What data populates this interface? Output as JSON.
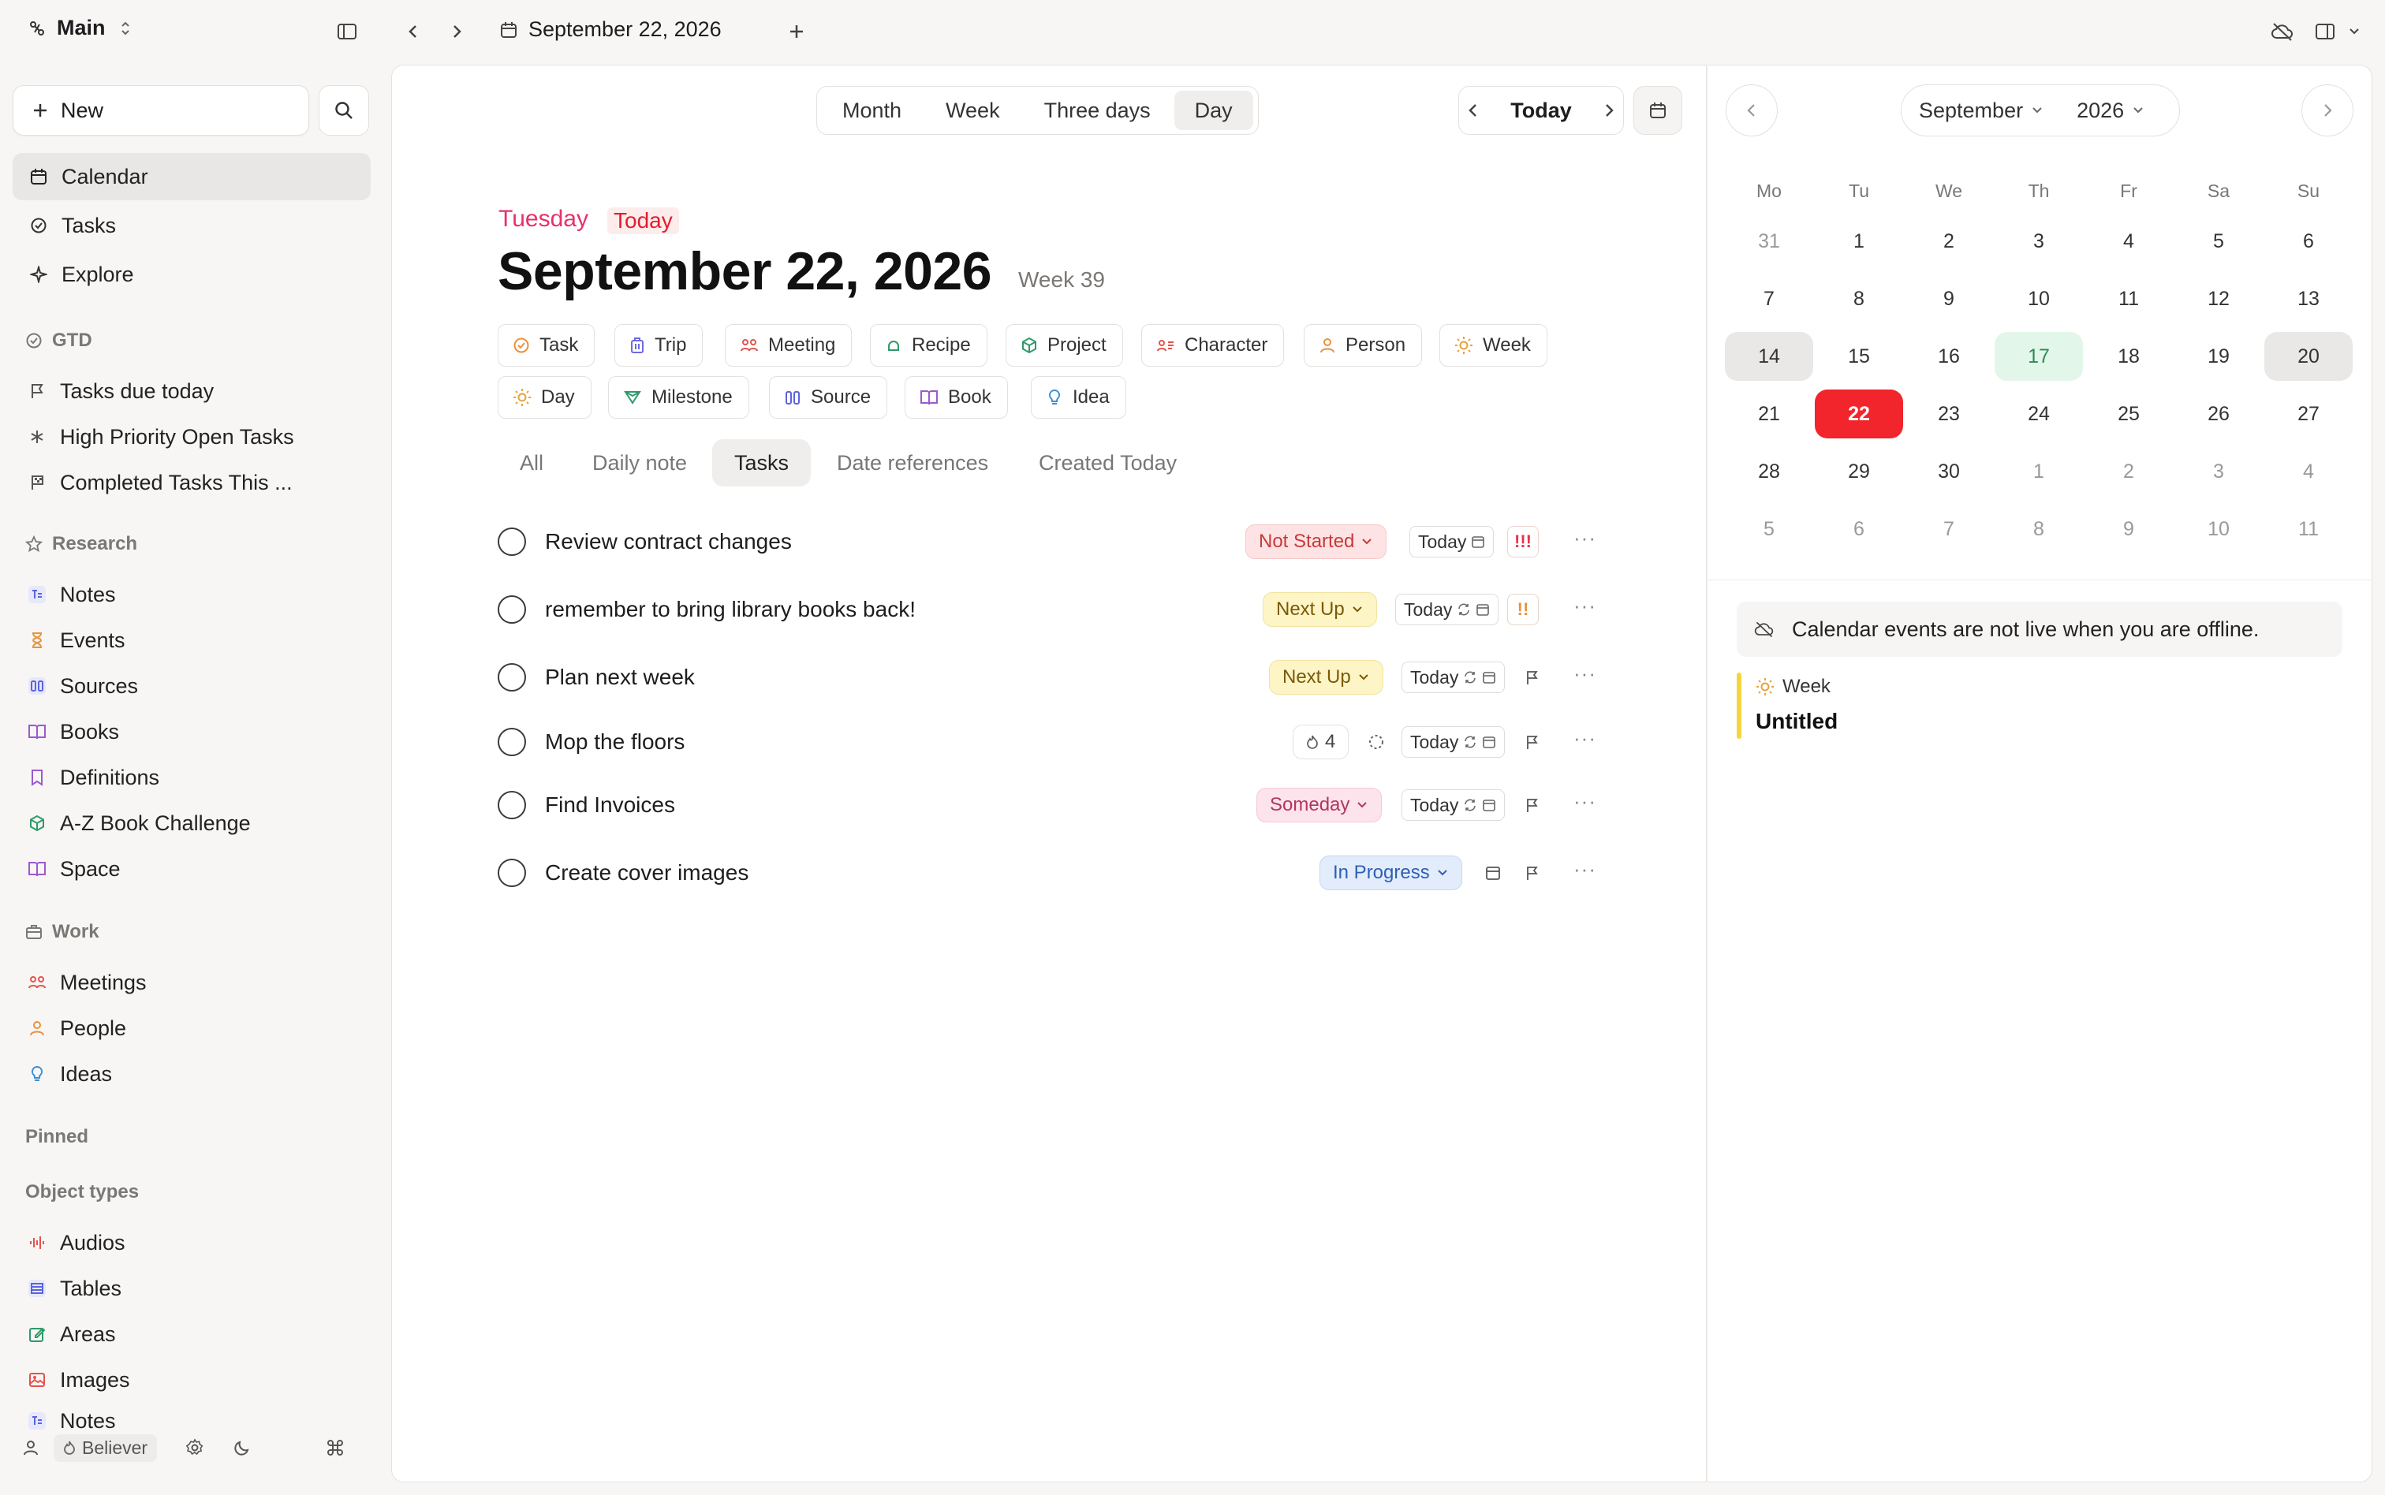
{
  "topbar": {
    "workspace": "Main",
    "date_title": "September 22, 2026"
  },
  "sidebar": {
    "new_label": "New",
    "nav": [
      {
        "label": "Calendar"
      },
      {
        "label": "Tasks"
      },
      {
        "label": "Explore"
      }
    ],
    "gtd": {
      "title": "GTD",
      "items": [
        {
          "label": "Tasks due today"
        },
        {
          "label": "High Priority Open Tasks"
        },
        {
          "label": "Completed Tasks This ..."
        }
      ]
    },
    "research": {
      "title": "Research",
      "items": [
        {
          "label": "Notes"
        },
        {
          "label": "Events"
        },
        {
          "label": "Sources"
        },
        {
          "label": "Books"
        },
        {
          "label": "Definitions"
        },
        {
          "label": "A-Z Book Challenge"
        },
        {
          "label": "Space"
        }
      ]
    },
    "work": {
      "title": "Work",
      "items": [
        {
          "label": "Meetings"
        },
        {
          "label": "People"
        },
        {
          "label": "Ideas"
        }
      ]
    },
    "pinned_title": "Pinned",
    "object_types": {
      "title": "Object types",
      "items": [
        {
          "label": "Audios"
        },
        {
          "label": "Tables"
        },
        {
          "label": "Areas"
        },
        {
          "label": "Images"
        },
        {
          "label": "Notes"
        }
      ]
    },
    "bottom": {
      "plan": "Believer"
    }
  },
  "main": {
    "view_modes": [
      "Month",
      "Week",
      "Three days",
      "Day"
    ],
    "active_view": "Day",
    "today_btn": "Today",
    "day_name": "Tuesday",
    "today_tag": "Today",
    "date_heading": "September 22, 2026",
    "week_label": "Week 39",
    "type_chips": [
      {
        "label": "Task",
        "icon": "task-icon",
        "color": "#e8923c"
      },
      {
        "label": "Trip",
        "icon": "trip-icon",
        "color": "#6e6ae0"
      },
      {
        "label": "Meeting",
        "icon": "meeting-icon",
        "color": "#e5534b"
      },
      {
        "label": "Recipe",
        "icon": "recipe-icon",
        "color": "#2e9a6a"
      },
      {
        "label": "Project",
        "icon": "project-icon",
        "color": "#2e9a6a"
      },
      {
        "label": "Character",
        "icon": "character-icon",
        "color": "#e5534b"
      },
      {
        "label": "Person",
        "icon": "person-icon",
        "color": "#e8923c"
      },
      {
        "label": "Week",
        "icon": "sun-icon",
        "color": "#e8a23c"
      },
      {
        "label": "Day",
        "icon": "sun-icon",
        "color": "#e8a23c"
      },
      {
        "label": "Milestone",
        "icon": "milestone-icon",
        "color": "#2e9a6a"
      },
      {
        "label": "Source",
        "icon": "source-icon",
        "color": "#5c64d9"
      },
      {
        "label": "Book",
        "icon": "book-icon",
        "color": "#9b59d0"
      },
      {
        "label": "Idea",
        "icon": "idea-icon",
        "color": "#3a8fd6"
      }
    ],
    "tabs": [
      "All",
      "Daily note",
      "Tasks",
      "Date references",
      "Created Today"
    ],
    "active_tab": "Tasks",
    "tasks": [
      {
        "title": "Review contract changes",
        "status": "Not Started",
        "date": "Today",
        "priority": "!!!"
      },
      {
        "title": "remember to bring library books back!",
        "status": "Next Up",
        "date": "Today",
        "priority": "!!"
      },
      {
        "title": "Plan next week",
        "status": "Next Up",
        "date": "Today"
      },
      {
        "title": "Mop the floors",
        "count": "4",
        "date": "Today"
      },
      {
        "title": "Find Invoices",
        "status": "Someday",
        "date": "Today"
      },
      {
        "title": "Create cover images",
        "status": "In Progress"
      }
    ]
  },
  "right": {
    "month": "September",
    "year": "2026",
    "weekdays": [
      "Mo",
      "Tu",
      "We",
      "Th",
      "Fr",
      "Sa",
      "Su"
    ],
    "weeks": [
      [
        "31",
        "1",
        "2",
        "3",
        "4",
        "5",
        "6"
      ],
      [
        "7",
        "8",
        "9",
        "10",
        "11",
        "12",
        "13"
      ],
      [
        "14",
        "15",
        "16",
        "17",
        "18",
        "19",
        "20"
      ],
      [
        "21",
        "22",
        "23",
        "24",
        "25",
        "26",
        "27"
      ],
      [
        "28",
        "29",
        "30",
        "1",
        "2",
        "3",
        "4"
      ],
      [
        "5",
        "6",
        "7",
        "8",
        "9",
        "10",
        "11"
      ]
    ],
    "selected_day": "22",
    "offline_notice": "Calendar events are not live when you are offline.",
    "event": {
      "type": "Week",
      "title": "Untitled"
    }
  }
}
